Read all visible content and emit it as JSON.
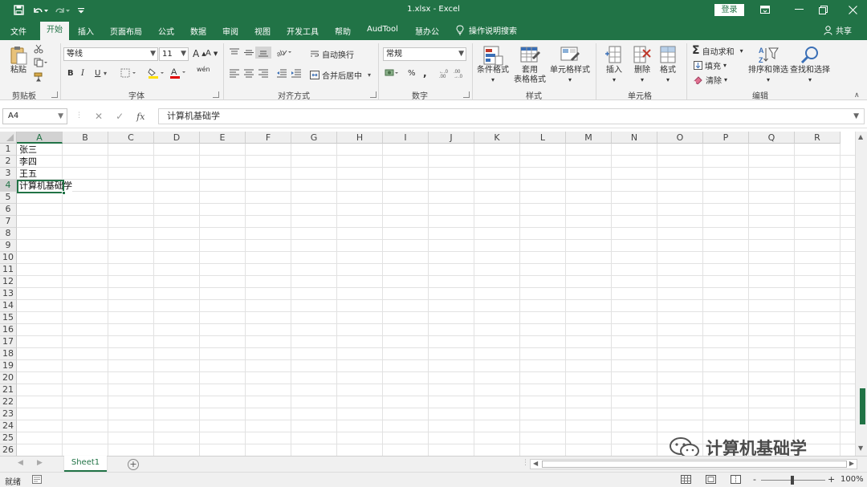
{
  "titlebar": {
    "title": "1.xlsx  -  Excel",
    "login_label": "登录",
    "quick_access": [
      "save-icon",
      "undo-icon",
      "redo-icon",
      "customize-icon"
    ]
  },
  "tabs": {
    "items": [
      "文件",
      "开始",
      "插入",
      "页面布局",
      "公式",
      "数据",
      "审阅",
      "视图",
      "开发工具",
      "帮助",
      "AudTool",
      "慧办公"
    ],
    "active": "开始",
    "tell_me": "操作说明搜索",
    "share": "共享"
  },
  "ribbon": {
    "clipboard": {
      "paste": "粘贴",
      "label": "剪贴板"
    },
    "font": {
      "name": "等线",
      "size": "11",
      "label": "字体",
      "bold": "B",
      "italic": "I",
      "underline": "U",
      "grow": "A",
      "shrink": "A",
      "phonetic": "wén"
    },
    "alignment": {
      "wrap": "自动换行",
      "merge": "合并后居中",
      "label": "对齐方式"
    },
    "number": {
      "format": "常规",
      "label": "数字",
      "percent": "%",
      "comma": ","
    },
    "styles": {
      "conditional": "条件格式",
      "table_l1": "套用",
      "table_l2": "表格格式",
      "cell_styles": "单元格样式",
      "label": "样式"
    },
    "cells": {
      "insert": "插入",
      "delete": "删除",
      "format": "格式",
      "label": "单元格"
    },
    "editing": {
      "autosum": "自动求和",
      "fill": "填充",
      "clear": "清除",
      "sort": "排序和筛选",
      "find": "查找和选择",
      "label": "编辑"
    }
  },
  "formula_bar": {
    "name_box": "A4",
    "fx": "fx",
    "content": "计算机基础学"
  },
  "grid": {
    "columns": [
      "A",
      "B",
      "C",
      "D",
      "E",
      "F",
      "G",
      "H",
      "I",
      "J",
      "K",
      "L",
      "M",
      "N",
      "O",
      "P",
      "Q",
      "R"
    ],
    "rows": [
      "1",
      "2",
      "3",
      "4",
      "5",
      "6",
      "7",
      "8",
      "9",
      "10",
      "11",
      "12",
      "13",
      "14",
      "15",
      "16",
      "17",
      "18",
      "19",
      "20",
      "21",
      "22",
      "23",
      "24",
      "25",
      "26"
    ],
    "cells": {
      "A1": "张三",
      "A2": "李四",
      "A3": "王五",
      "A4": "计算机基础学"
    },
    "selected": "A4"
  },
  "sheets": {
    "tabs": [
      "Sheet1"
    ],
    "active": "Sheet1",
    "add": "+"
  },
  "status": {
    "ready": "就绪",
    "zoom": "100%",
    "zoom_minus": "-",
    "zoom_plus": "+"
  },
  "watermark": {
    "text": "计算机基础学"
  },
  "colors": {
    "accent": "#217346",
    "ribbon_bg": "#f3f3f3",
    "gridline": "#e2e2e2"
  }
}
